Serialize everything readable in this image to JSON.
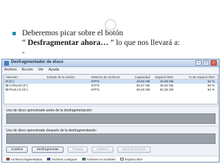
{
  "slide": {
    "line1": "Deberemos picar sobre el botón",
    "line2_prefix": "“ ",
    "line2_bold": "Desfragmentar ahora…",
    "line2_suffix": " ” lo que nos llevará a:",
    "line3": "-"
  },
  "window": {
    "title": "Desfragmentador de disco",
    "menu": [
      "Archivo",
      "Acción",
      "Ver",
      "Ayuda"
    ],
    "columns": [
      "Volumen",
      "Estado de la sesión",
      "Sistema de archivos",
      "Capacidad",
      "Espacio libre",
      "% de espacio libre"
    ],
    "rows": [
      [
        "(C:)",
        "",
        "NTFS",
        "19,53 GB",
        "10,28 GB",
        "52 %"
      ],
      [
        "CARLOS (F:)",
        "",
        "NTFS",
        "63,47 GB",
        "45,92 GB",
        "69 %"
      ],
      [
        "PAULAS (G:)",
        "",
        "NTFS",
        "66,03 GB",
        "62,35 GB",
        "94 %"
      ]
    ],
    "section_before": "Uso de disco aproximado antes de la desfragmentación:",
    "section_after": "Uso de disco aproximado después de la desfragmentación:",
    "buttons": [
      {
        "label": "Analizar",
        "enabled": true
      },
      {
        "label": "Desfragmentar",
        "enabled": true
      },
      {
        "label": "Pausar",
        "enabled": false
      },
      {
        "label": "Detener",
        "enabled": false
      },
      {
        "label": "Mostrar informe",
        "enabled": false
      }
    ],
    "legend": [
      {
        "label": "Archivos fragmentados",
        "color": "#e03c31"
      },
      {
        "label": "Archivos contiguos",
        "color": "#2a55c8"
      },
      {
        "label": "Archivos no movibles",
        "color": "#2fa84a"
      },
      {
        "label": "Espacio libre",
        "color": "#ffffff"
      }
    ]
  }
}
